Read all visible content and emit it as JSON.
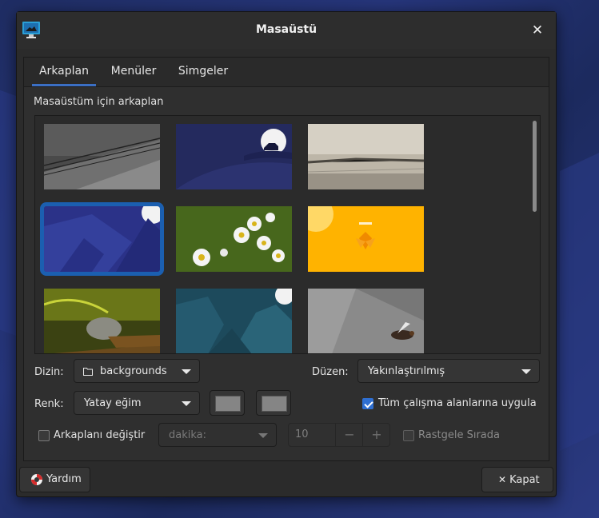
{
  "dialog": {
    "title": "Masaüstü"
  },
  "tabs": [
    {
      "label": "Arkaplan",
      "active": true
    },
    {
      "label": "Menüler",
      "active": false
    },
    {
      "label": "Simgeler",
      "active": false
    }
  ],
  "background_section": {
    "label": "Masaüstüm için arkaplan",
    "selected_index": 3
  },
  "controls": {
    "folder_label": "Dizin:",
    "folder_value": "backgrounds",
    "style_label": "Düzen:",
    "style_value": "Yakınlaştırılmış",
    "color_label": "Renk:",
    "color_value": "Yatay eğim",
    "color1": "#858585",
    "color2": "#858585",
    "apply_all_label": "Tüm çalışma alanlarına uygula",
    "apply_all_checked": true,
    "change_bg_label": "Arkaplanı değiştir",
    "change_bg_checked": false,
    "interval_value": "dakika:",
    "interval_number": "10",
    "minus": "−",
    "plus": "+",
    "random_label": "Rastgele Sırada",
    "random_checked": false
  },
  "footer": {
    "help_label": "Yardım",
    "close_label": "Kapat",
    "close_glyph": "✕"
  },
  "colors": {
    "accent": "#2f6fd1",
    "selection": "#1b5fb0"
  }
}
